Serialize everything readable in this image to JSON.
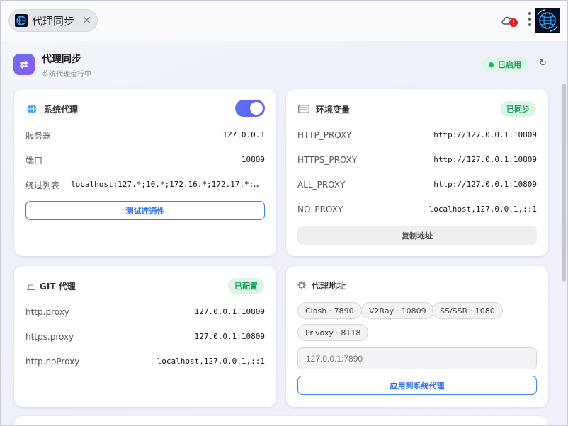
{
  "tab": {
    "title": "代理同步",
    "close": "✕"
  },
  "header": {
    "title": "代理同步",
    "subtitle": "系统代理运行中",
    "status": "已启用",
    "refresh": "↻"
  },
  "system_proxy": {
    "title": "系统代理",
    "enabled": true,
    "rows": [
      {
        "label": "服务器",
        "value": "127.0.0.1"
      },
      {
        "label": "端口",
        "value": "10809"
      },
      {
        "label": "绕过列表",
        "value": "localhost;127.*;10.*;172.16.*;172.17.*;…"
      }
    ],
    "test_button": "测试连通性"
  },
  "env_vars": {
    "title": "环境变量",
    "badge": "已同步",
    "rows": [
      {
        "label": "HTTP_PROXY",
        "value": "http://127.0.0.1:10809"
      },
      {
        "label": "HTTPS_PROXY",
        "value": "http://127.0.0.1:10809"
      },
      {
        "label": "ALL_PROXY",
        "value": "http://127.0.0.1:10809"
      },
      {
        "label": "NO_PROXY",
        "value": "localhost,127.0.0.1,::1"
      }
    ],
    "copy_button": "复制地址"
  },
  "git_proxy": {
    "title": "GIT 代理",
    "badge": "已配置",
    "rows": [
      {
        "label": "http.proxy",
        "value": "127.0.0.1:10809"
      },
      {
        "label": "https.proxy",
        "value": "127.0.0.1:10809"
      },
      {
        "label": "http.noProxy",
        "value": "localhost,127.0.0.1,::1"
      }
    ]
  },
  "proxy_address": {
    "title": "代理地址",
    "presets": [
      "Clash · 7890",
      "V2Ray · 10809",
      "SS/SSR · 1080",
      "Privoxy · 8118"
    ],
    "input_placeholder": "127.0.0.1:7890",
    "apply_button": "应用到系统代理"
  },
  "colors": {
    "accent": "#3b82f6",
    "success": "#1e9f5d",
    "toggle": "#5b72f0"
  }
}
